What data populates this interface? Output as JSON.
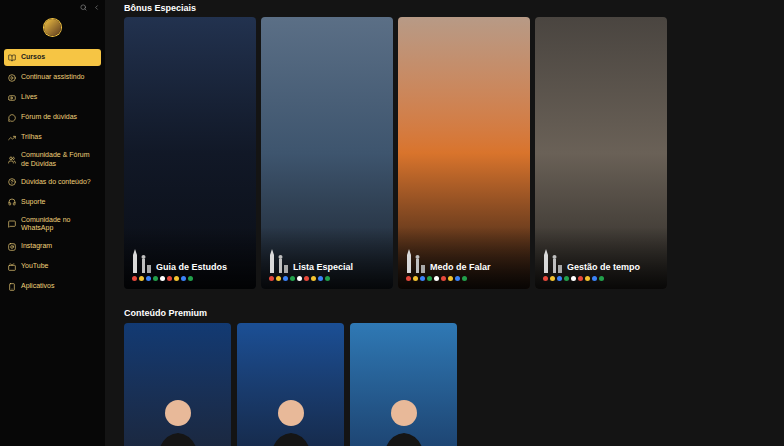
{
  "sidebar": {
    "items": [
      {
        "label": "Cursos",
        "selected": true
      },
      {
        "label": "Continuar assistindo",
        "selected": false
      },
      {
        "label": "Lives",
        "selected": false
      },
      {
        "label": "Fórum de dúvidas",
        "selected": false
      },
      {
        "label": "Trilhas",
        "selected": false
      },
      {
        "label": "Comunidade & Fórum de Dúvidas",
        "selected": false
      },
      {
        "label": "Dúvidas do conteúdo?",
        "selected": false
      },
      {
        "label": "Suporte",
        "selected": false
      },
      {
        "label": "Comunidade no WhatsApp",
        "selected": false
      },
      {
        "label": "Instagram",
        "selected": false
      },
      {
        "label": "YouTube",
        "selected": false
      },
      {
        "label": "Aplicativos",
        "selected": false
      }
    ]
  },
  "sections": [
    {
      "title": "Bônus Especiais",
      "cards": [
        {
          "title": "Guia de Estudos"
        },
        {
          "title": "Lista Especial"
        },
        {
          "title": "Medo de Falar"
        },
        {
          "title": "Gestão de tempo"
        }
      ]
    },
    {
      "title": "Conteúdo Premium",
      "cards": [
        {
          "title": ""
        },
        {
          "title": ""
        },
        {
          "title": ""
        }
      ]
    }
  ]
}
